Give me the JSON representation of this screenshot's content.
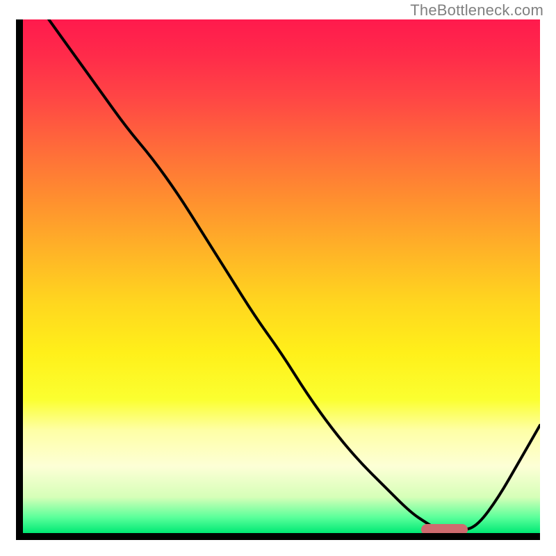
{
  "watermark": "TheBottleneck.com",
  "colors": {
    "axis": "#000000",
    "curve": "#000000",
    "marker": "#ce6b6f",
    "gradient_top": "#ff1a4d",
    "gradient_mid": "#ffd61f",
    "gradient_bottom": "#00e874"
  },
  "chart_data": {
    "type": "line",
    "title": "",
    "xlabel": "",
    "ylabel": "",
    "xlim": [
      0,
      100
    ],
    "ylim": [
      0,
      100
    ],
    "grid": false,
    "legend": false,
    "series": [
      {
        "name": "curve",
        "x": [
          5,
          10,
          15,
          20,
          25,
          30,
          35,
          40,
          45,
          50,
          55,
          60,
          65,
          70,
          75,
          78,
          80,
          82,
          85,
          88,
          92,
          96,
          100
        ],
        "values": [
          100,
          93,
          86,
          79,
          73,
          66,
          58,
          50,
          42,
          35,
          27,
          20,
          14,
          9,
          4,
          2,
          0.8,
          0.4,
          0.4,
          1.5,
          7,
          14,
          21
        ]
      }
    ],
    "marker_region": {
      "x_start": 77,
      "x_end": 86,
      "y": 0.7
    },
    "background": "vertical-gradient-red-to-green",
    "description": "A single black curve on a full-area heat gradient (red at top through yellow to green at bottom). The curve starts at the top-left, descends steeply to a minimum near x≈82, then rises toward the right edge. A rounded horizontal pink marker highlights the basin of the minimum."
  }
}
